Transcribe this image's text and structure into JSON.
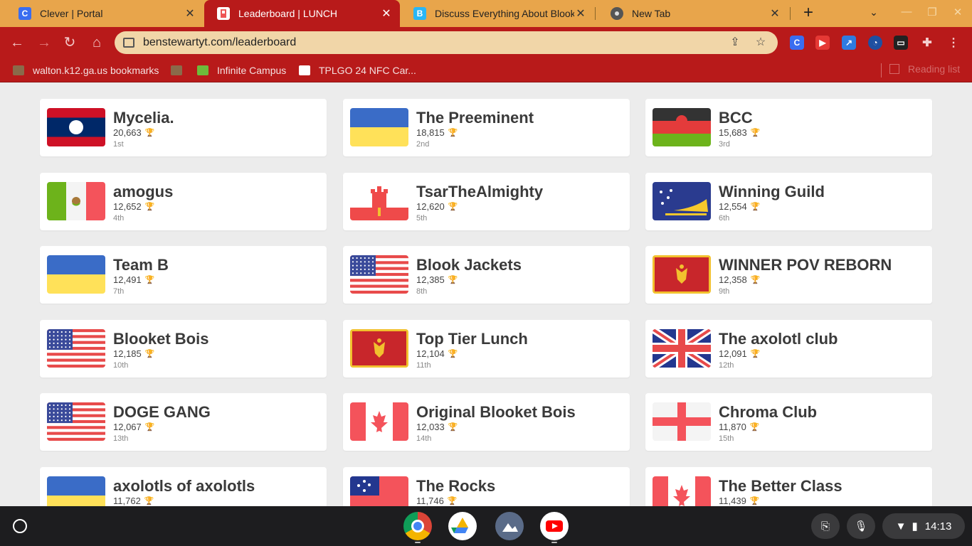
{
  "browser": {
    "tabs": [
      {
        "title": "Clever | Portal",
        "icon": "clever-icon",
        "fav_text": "C",
        "fav_color": "#3a6df0"
      },
      {
        "title": "Leaderboard | LUNCH",
        "icon": "leaderboard-icon",
        "fav_text": "",
        "fav_color": "#ffffff"
      },
      {
        "title": "Discuss Everything About Blooke",
        "icon": "blooket-icon",
        "fav_text": "B",
        "fav_color": "#29b6f6"
      },
      {
        "title": "New Tab",
        "icon": "chrome-icon",
        "fav_text": "",
        "fav_color": "#555555"
      }
    ],
    "close_glyph": "✕",
    "new_tab_glyph": "+",
    "url": "benstewartyt.com/leaderboard"
  },
  "bookmarks": [
    {
      "label": "walton.k12.ga.us bookmarks",
      "icon": "folder-icon"
    },
    {
      "label": "",
      "icon": "folder-icon"
    },
    {
      "label": "Infinite Campus",
      "icon": "infinite-campus-icon"
    },
    {
      "label": "TPLGO 24 NFC Car...",
      "icon": "amazon-icon"
    }
  ],
  "reading_list": "Reading list",
  "leaderboard": [
    {
      "name": "Mycelia.",
      "score": "20,663",
      "rank": "1st",
      "flag": "laos"
    },
    {
      "name": "The Preeminent",
      "score": "18,815",
      "rank": "2nd",
      "flag": "ukraine"
    },
    {
      "name": "BCC",
      "score": "15,683",
      "rank": "3rd",
      "flag": "malawi"
    },
    {
      "name": "amogus",
      "score": "12,652",
      "rank": "4th",
      "flag": "mexico"
    },
    {
      "name": "TsarTheAlmighty",
      "score": "12,620",
      "rank": "5th",
      "flag": "gibraltar"
    },
    {
      "name": "Winning Guild",
      "score": "12,554",
      "rank": "6th",
      "flag": "tokelau"
    },
    {
      "name": "Team B",
      "score": "12,491",
      "rank": "7th",
      "flag": "ukraine"
    },
    {
      "name": "Blook Jackets",
      "score": "12,385",
      "rank": "8th",
      "flag": "usa"
    },
    {
      "name": "WINNER POV REBORN",
      "score": "12,358",
      "rank": "9th",
      "flag": "montenegro"
    },
    {
      "name": "Blooket Bois",
      "score": "12,185",
      "rank": "10th",
      "flag": "usa"
    },
    {
      "name": "Top Tier Lunch",
      "score": "12,104",
      "rank": "11th",
      "flag": "montenegro"
    },
    {
      "name": "The axolotl club",
      "score": "12,091",
      "rank": "12th",
      "flag": "uk"
    },
    {
      "name": "DOGE GANG",
      "score": "12,067",
      "rank": "13th",
      "flag": "usa"
    },
    {
      "name": "Original Blooket Bois",
      "score": "12,033",
      "rank": "14th",
      "flag": "canada"
    },
    {
      "name": "Chroma Club",
      "score": "11,870",
      "rank": "15th",
      "flag": "england"
    },
    {
      "name": "axolotls of axolotls",
      "score": "11,762",
      "rank": "",
      "flag": "ukraine"
    },
    {
      "name": "The Rocks",
      "score": "11,746",
      "rank": "",
      "flag": "samoa"
    },
    {
      "name": "The Better Class",
      "score": "11,439",
      "rank": "",
      "flag": "canada"
    }
  ],
  "trophy_glyph": "🏆",
  "shelf": {
    "apps": [
      "chrome-icon",
      "google-drive-icon",
      "gallery-icon",
      "youtube-icon"
    ],
    "time": "14:13"
  },
  "colors": {
    "accent": "#b81a1a",
    "tabstrip": "#e8a54b",
    "omnibox": "#f1d6a8"
  }
}
